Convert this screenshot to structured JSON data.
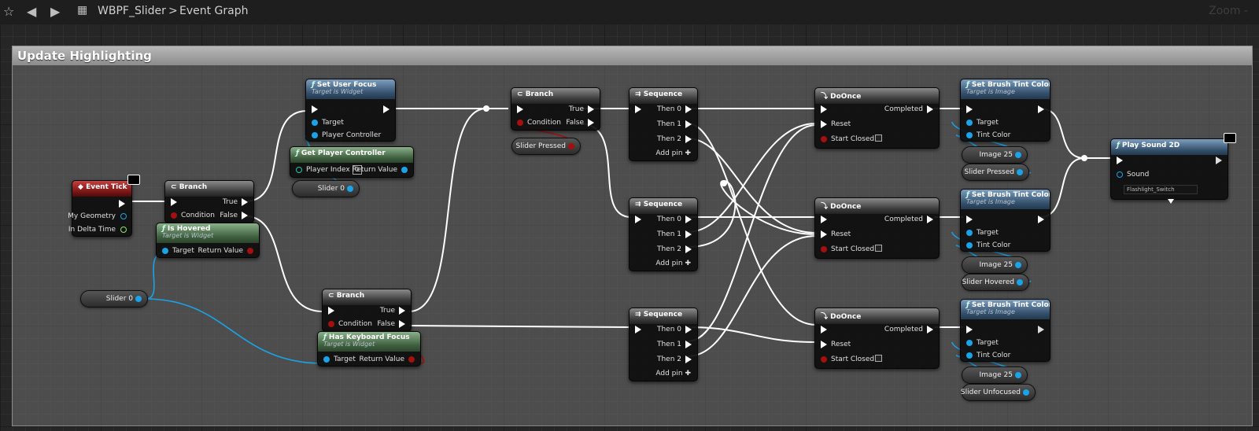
{
  "toolbar": {
    "breadcrumb_bp": "WBPF_Slider",
    "separator": ">",
    "breadcrumb_graph": "Event Graph",
    "zoom": "Zoom -"
  },
  "comment": {
    "title": "Update Highlighting"
  },
  "labels": {
    "true": "True",
    "false": "False",
    "condition": "Condition",
    "target": "Target",
    "return_value": "Return Value",
    "then0": "Then 0",
    "then1": "Then 1",
    "then2": "Then 2",
    "add_pin": "Add pin",
    "completed": "Completed",
    "reset": "Reset",
    "start_closed": "Start Closed",
    "tint_color": "Tint Color",
    "target_is_widget": "Target is Widget",
    "target_is_image": "Target is Image",
    "player_controller": "Player Controller",
    "player_index": "Player Index",
    "sound": "Sound"
  },
  "nodes": {
    "event_tick": {
      "title": "Event Tick",
      "my_geometry": "My Geometry",
      "in_delta_time": "In Delta Time"
    },
    "branch": "Branch",
    "sequence": "Sequence",
    "doonce": "DoOnce",
    "set_user_focus": "Set User Focus",
    "get_player_controller": {
      "title": "Get Player Controller",
      "index": "0"
    },
    "is_hovered": "Is Hovered",
    "has_keyboard_focus": "Has Keyboard Focus",
    "set_brush_tint": "Set Brush Tint Color",
    "play_sound": {
      "title": "Play Sound 2D",
      "sound_value": "Flashlight_Switch"
    }
  },
  "variables": {
    "slider0": "Slider 0",
    "slider_pressed": "Slider Pressed",
    "image25": "Image 25",
    "slider_hovered": "Slider Hovered",
    "slider_unfocused": "Slider Unfocused"
  },
  "colors": {
    "exec_wire": "#ffffff",
    "object_pin": "#1aa3e8",
    "bool_pin": "#a40f0f",
    "func_header": "#34506b",
    "pure_header": "#3e5e3e",
    "event_header": "#7a1515"
  }
}
